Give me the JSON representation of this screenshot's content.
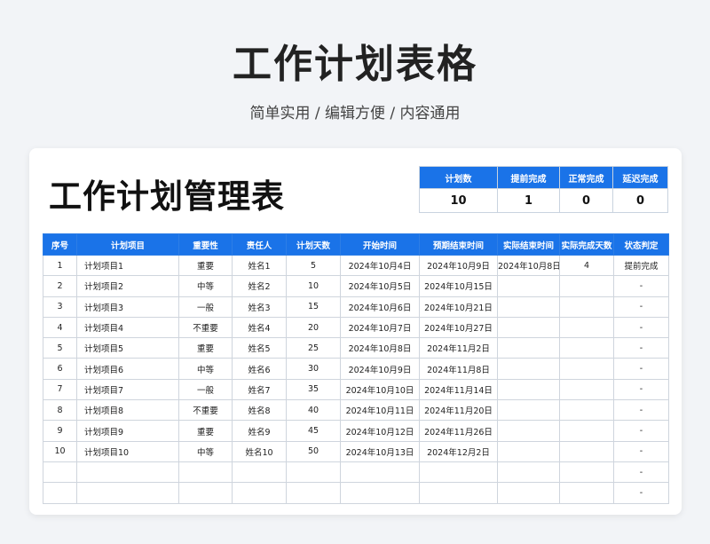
{
  "hero": {
    "title": "工作计划表格",
    "subtitle": "简单实用 / 编辑方便 / 内容通用"
  },
  "sheet": {
    "title": "工作计划管理表",
    "summary": {
      "headers": [
        "计划数",
        "提前完成",
        "正常完成",
        "延迟完成"
      ],
      "values": [
        "10",
        "1",
        "0",
        "0"
      ]
    },
    "columns": [
      "序号",
      "计划项目",
      "重要性",
      "责任人",
      "计划天数",
      "开始时间",
      "预期结束时间",
      "实际结束时间",
      "实际完成天数",
      "状态判定"
    ],
    "rows": [
      [
        "1",
        "计划项目1",
        "重要",
        "姓名1",
        "5",
        "2024年10月4日",
        "2024年10月9日",
        "2024年10月8日",
        "4",
        "提前完成"
      ],
      [
        "2",
        "计划项目2",
        "中等",
        "姓名2",
        "10",
        "2024年10月5日",
        "2024年10月15日",
        "",
        "",
        "-"
      ],
      [
        "3",
        "计划项目3",
        "一般",
        "姓名3",
        "15",
        "2024年10月6日",
        "2024年10月21日",
        "",
        "",
        "-"
      ],
      [
        "4",
        "计划项目4",
        "不重要",
        "姓名4",
        "20",
        "2024年10月7日",
        "2024年10月27日",
        "",
        "",
        "-"
      ],
      [
        "5",
        "计划项目5",
        "重要",
        "姓名5",
        "25",
        "2024年10月8日",
        "2024年11月2日",
        "",
        "",
        "-"
      ],
      [
        "6",
        "计划项目6",
        "中等",
        "姓名6",
        "30",
        "2024年10月9日",
        "2024年11月8日",
        "",
        "",
        "-"
      ],
      [
        "7",
        "计划项目7",
        "一般",
        "姓名7",
        "35",
        "2024年10月10日",
        "2024年11月14日",
        "",
        "",
        "-"
      ],
      [
        "8",
        "计划项目8",
        "不重要",
        "姓名8",
        "40",
        "2024年10月11日",
        "2024年11月20日",
        "",
        "",
        "-"
      ],
      [
        "9",
        "计划项目9",
        "重要",
        "姓名9",
        "45",
        "2024年10月12日",
        "2024年11月26日",
        "",
        "",
        "-"
      ],
      [
        "10",
        "计划项目10",
        "中等",
        "姓名10",
        "50",
        "2024年10月13日",
        "2024年12月2日",
        "",
        "",
        "-"
      ],
      [
        "",
        "",
        "",
        "",
        "",
        "",
        "",
        "",
        "",
        "-"
      ],
      [
        "",
        "",
        "",
        "",
        "",
        "",
        "",
        "",
        "",
        "-"
      ]
    ]
  },
  "colors": {
    "header_blue": "#1a73e8",
    "page_bg": "#f2f4f7",
    "card_bg": "#ffffff",
    "grid_line": "#cfd5dd"
  }
}
